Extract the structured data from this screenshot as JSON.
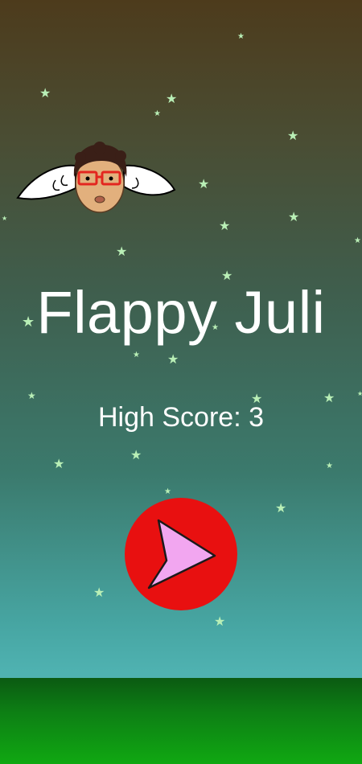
{
  "game": {
    "title": "Flappy Juli",
    "high_score_label": "High Score: 3",
    "play_icon": "play-triangle-icon",
    "character_icon": "winged-head-character"
  },
  "colors": {
    "sky_top": "#4d3b1c",
    "sky_bottom": "#4fb2b1",
    "star": "#b9efb6",
    "play_button": "#e81010",
    "play_triangle": "#f2a6f0",
    "ground": "#10a812"
  }
}
